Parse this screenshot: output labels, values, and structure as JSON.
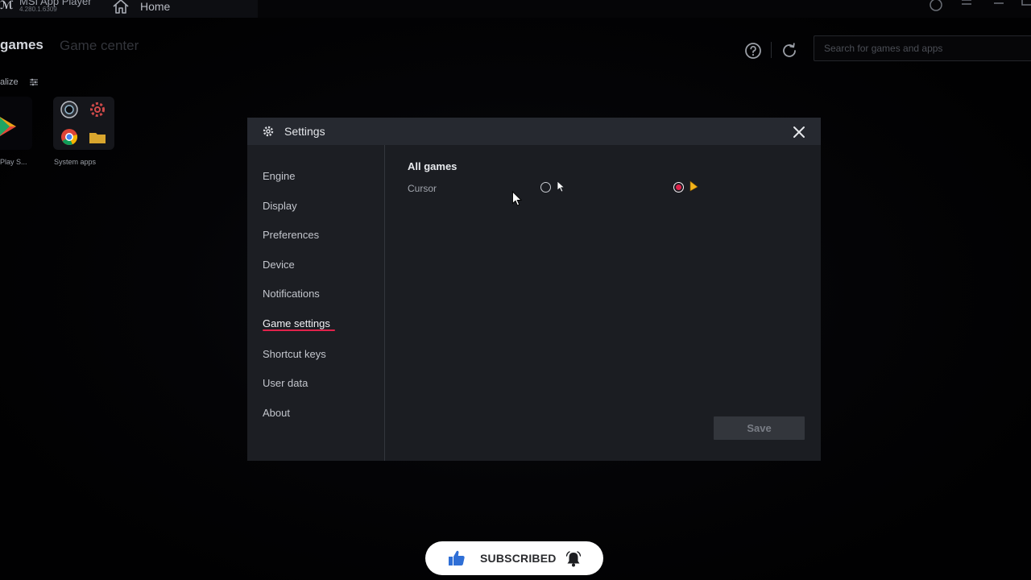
{
  "titlebar": {
    "app_name": "MSI App Player",
    "app_version": "4.280.1.6309",
    "home_label": "Home"
  },
  "library": {
    "tabs": [
      {
        "label": "games",
        "active": true
      },
      {
        "label": "Game center",
        "active": false
      }
    ],
    "personalize_label": "alize",
    "search_placeholder": "Search for games and apps",
    "apps": [
      {
        "label": "Play S..."
      },
      {
        "label": "System apps"
      }
    ]
  },
  "settings": {
    "title": "Settings",
    "nav": [
      {
        "label": "Engine"
      },
      {
        "label": "Display"
      },
      {
        "label": "Preferences"
      },
      {
        "label": "Device"
      },
      {
        "label": "Notifications"
      },
      {
        "label": "Game settings",
        "active": true
      },
      {
        "label": "Shortcut keys"
      },
      {
        "label": "User data"
      },
      {
        "label": "About"
      }
    ],
    "section_title": "All games",
    "cursor_label": "Cursor",
    "cursor_options": [
      {
        "style": "default",
        "selected": false
      },
      {
        "style": "custom",
        "selected": true
      }
    ],
    "save_label": "Save"
  },
  "overlay": {
    "subscribed_label": "SUBSCRIBED"
  },
  "colors": {
    "accent": "#e0234b",
    "cursor_custom": "#f4b41a",
    "thumb_blue": "#2f6fd6"
  },
  "icons": {
    "home": "home-icon",
    "settings": "gear-icon",
    "close": "close-icon",
    "help": "help-icon",
    "refresh": "refresh-icon",
    "like": "thumbs-up-icon",
    "bell": "bell-icon"
  }
}
